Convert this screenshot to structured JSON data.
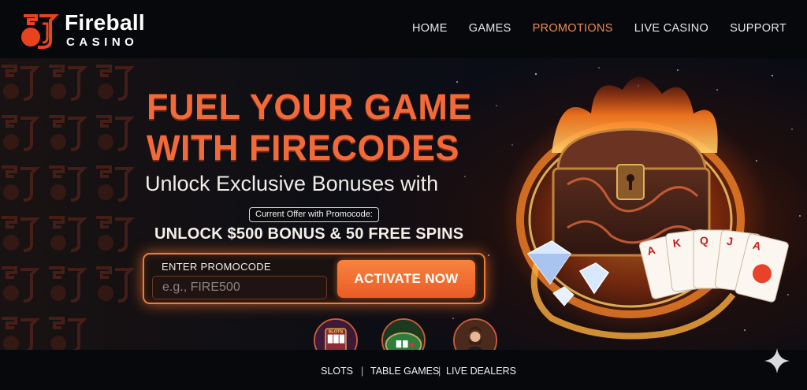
{
  "brand": {
    "name": "Fireball",
    "sub": "CASINO",
    "accent": "#f26a3a",
    "logo_icon": "fireball-logo-icon"
  },
  "nav": {
    "items": [
      {
        "label": "HOME",
        "active": false
      },
      {
        "label": "GAMES",
        "active": false
      },
      {
        "label": "PROMOTIONS",
        "active": true
      },
      {
        "label": "LIVE CASINO",
        "active": false
      },
      {
        "label": "SUPPORT",
        "active": false
      }
    ]
  },
  "hero": {
    "headline_line1": "FUEL YOUR GAME",
    "headline_line2": "WITH FIRECODES",
    "subhead": "Unlock Exclusive Bonuses with",
    "offer_pill": "Current Offer with Promocode:",
    "offer_text": "UNLOCK $500 BONUS & 50 FREE SPINS",
    "art": [
      "treasure-chest-icon",
      "flame-ring-icon",
      "diamond-icon",
      "playing-cards-icon"
    ]
  },
  "promo": {
    "label": "ENTER PROMOCODE",
    "placeholder": "e.g., FIRE500",
    "value": "",
    "button_label": "ACTIVATE NOW"
  },
  "categories": [
    {
      "label": "SLOTS",
      "icon": "slot-machine-icon"
    },
    {
      "label": "TABLE GAMES",
      "icon": "card-table-icon"
    },
    {
      "label": "LIVE DEALERS",
      "icon": "live-dealer-icon"
    }
  ],
  "separator": "|",
  "corner_icon": "sparkle-icon"
}
